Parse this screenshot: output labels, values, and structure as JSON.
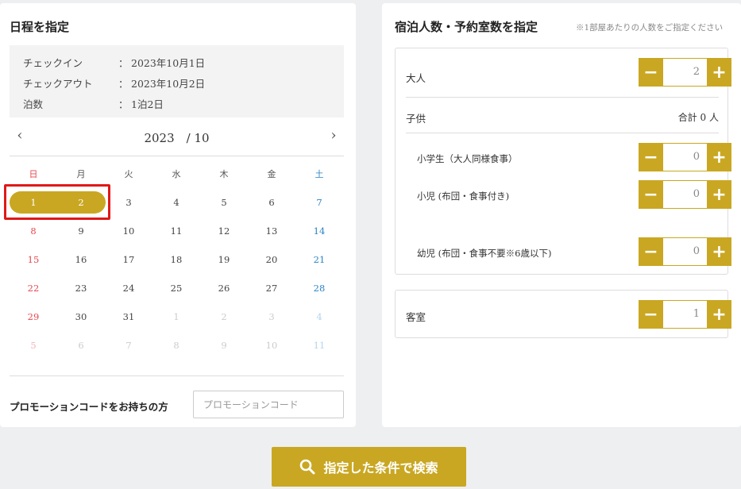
{
  "date_panel": {
    "title": "日程を指定",
    "summary": [
      {
        "label": "チェックイン",
        "value": "2023年10月1日"
      },
      {
        "label": "チェックアウト",
        "value": "2023年10月2日"
      },
      {
        "label": "泊数",
        "value": "1泊2日"
      }
    ],
    "summary_colon": "：",
    "calendar": {
      "prev_icon": "‹",
      "next_icon": "›",
      "month_label": "2023　/ 10",
      "weekdays": [
        "日",
        "月",
        "火",
        "水",
        "木",
        "金",
        "土"
      ],
      "weeks": [
        [
          "1",
          "2",
          "3",
          "4",
          "5",
          "6",
          "7"
        ],
        [
          "8",
          "9",
          "10",
          "11",
          "12",
          "13",
          "14"
        ],
        [
          "15",
          "16",
          "17",
          "18",
          "19",
          "20",
          "21"
        ],
        [
          "22",
          "23",
          "24",
          "25",
          "26",
          "27",
          "28"
        ],
        [
          "29",
          "30",
          "31",
          "1",
          "2",
          "3",
          "4"
        ],
        [
          "5",
          "6",
          "7",
          "8",
          "9",
          "10",
          "11"
        ]
      ],
      "selected_range": [
        "1",
        "2"
      ],
      "colors": {
        "sunday": "#e8474d",
        "saturday": "#2a84c6",
        "accent": "#c9a722",
        "highlight": "#e01818"
      }
    },
    "promo": {
      "label": "プロモーションコードをお持ちの方",
      "placeholder": "プロモーションコード",
      "value": ""
    }
  },
  "guest_panel": {
    "title": "宿泊人数・予約室数を指定",
    "note": "※1部屋あたりの人数をご指定ください",
    "adults": {
      "label": "大人",
      "value": "2"
    },
    "children": {
      "label": "子供",
      "total": "合計 0 人"
    },
    "elementary": {
      "label": "小学生（大人同様食事）",
      "value": "0"
    },
    "toddler": {
      "label": "小児 (布団・食事付き)",
      "value": "0"
    },
    "infant": {
      "label": "幼児 (布団・食事不要※6歳以下)",
      "value": "0"
    },
    "rooms": {
      "label": "客室",
      "value": "1"
    },
    "minus_icon": "−",
    "plus_icon": "+"
  },
  "search_button": {
    "label": "指定した条件で検索",
    "icon": "search-icon"
  }
}
